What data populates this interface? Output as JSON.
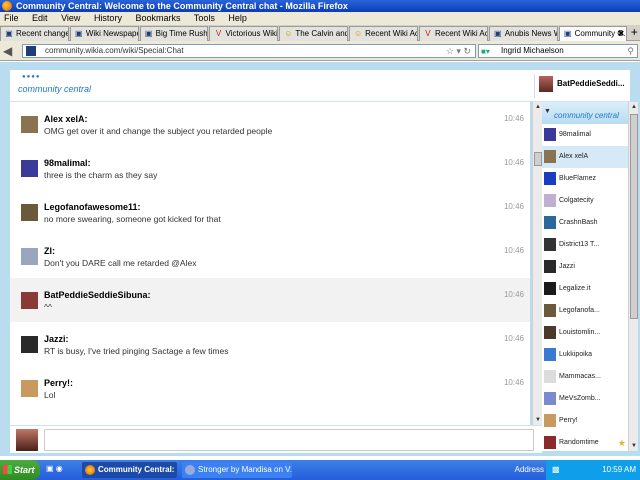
{
  "window": {
    "title": "Community Central: Welcome to the Community Central chat - Mozilla Firefox"
  },
  "menu": [
    "File",
    "Edit",
    "View",
    "History",
    "Bookmarks",
    "Tools",
    "Help"
  ],
  "tabs": [
    {
      "label": "Recent change...",
      "icon": "wiki-icon",
      "active": false
    },
    {
      "label": "Wiki Newspape...",
      "icon": "wiki-icon",
      "active": false
    },
    {
      "label": "Big Time Rush ...",
      "icon": "wiki-icon",
      "active": false
    },
    {
      "label": "Victorious Wiki ...",
      "icon": "v-icon",
      "active": false
    },
    {
      "label": "The Calvin and ...",
      "icon": "smiley-icon",
      "active": false
    },
    {
      "label": "Recent Wiki Ac...",
      "icon": "smiley-icon",
      "active": false
    },
    {
      "label": "Recent Wiki Ac...",
      "icon": "v-icon",
      "active": false
    },
    {
      "label": "Anubis News W...",
      "icon": "wiki-icon",
      "active": false
    },
    {
      "label": "Community C...",
      "icon": "wiki-icon",
      "active": true
    }
  ],
  "nav": {
    "url": "community.wikia.com/wiki/Special:Chat",
    "search_value": "Ingrid Michaelson"
  },
  "chat": {
    "logo_text": "community central",
    "current_user": "BatPeddieSeddi...",
    "room_name": "community central",
    "messages": [
      {
        "name": "Alex xelA:",
        "text": "OMG get over it and change the subject you retarded people",
        "time": "10:46",
        "avatar": "#8a7350",
        "highlight": false
      },
      {
        "name": "98malimal:",
        "text": "three is the charm as they say",
        "time": "10:46",
        "avatar": "#3a3a9a",
        "highlight": false
      },
      {
        "name": "Legofanofawesome11:",
        "text": "no more swearing, someone got kicked for that",
        "time": "10:46",
        "avatar": "#6b5a3a",
        "highlight": false
      },
      {
        "name": "Zl:",
        "text": "Don't you DARE call me retarded @Alex",
        "time": "10:46",
        "avatar": "#9aa6c0",
        "highlight": false
      },
      {
        "name": "BatPeddieSeddieSibuna:",
        "text": "^^",
        "time": "10:46",
        "avatar": "#8a3a34",
        "highlight": true
      },
      {
        "name": "Jazzi:",
        "text": "RT is busy, I've tried pinging Sactage a few times",
        "time": "10:46",
        "avatar": "#2a2a2a",
        "highlight": false
      },
      {
        "name": "Perry!:",
        "text": "Lol",
        "time": "10:46",
        "avatar": "#c89a60",
        "highlight": false
      }
    ],
    "users": [
      {
        "name": "98malimal",
        "avatar": "#3a3a9a",
        "selected": false
      },
      {
        "name": "Alex xelA",
        "avatar": "#8a7350",
        "selected": true
      },
      {
        "name": "BlueFlamez",
        "avatar": "#1a3cc0",
        "selected": false
      },
      {
        "name": "Colgatecity",
        "avatar": "#c0b0d0",
        "selected": false
      },
      {
        "name": "CrashnBash",
        "avatar": "#2a6a9a",
        "selected": false
      },
      {
        "name": "District13 T...",
        "avatar": "#333333",
        "selected": false
      },
      {
        "name": "Jazzi",
        "avatar": "#2a2a2a",
        "selected": false
      },
      {
        "name": "Legalize.it",
        "avatar": "#1a1a1a",
        "selected": false
      },
      {
        "name": "Legofanofa...",
        "avatar": "#6b5a3a",
        "selected": false
      },
      {
        "name": "Louistomlin...",
        "avatar": "#4a3a2a",
        "selected": false
      },
      {
        "name": "Lukkipoika",
        "avatar": "#3a7ad0",
        "selected": false
      },
      {
        "name": "Mammacas...",
        "avatar": "#dcdcdc",
        "selected": false
      },
      {
        "name": "MeVsZomb...",
        "avatar": "#7a8ad0",
        "selected": false
      },
      {
        "name": "Perry!",
        "avatar": "#c89a60",
        "selected": false
      },
      {
        "name": "Randomtime",
        "avatar": "#8a2a2a",
        "selected": false
      }
    ],
    "input_value": ""
  },
  "taskbar": {
    "start_label": "Start",
    "tasks": [
      {
        "label": "Community Central: ...",
        "active": true
      },
      {
        "label": "Stronger by Mandisa on V...",
        "active": false
      }
    ],
    "address_label": "Address",
    "clock": "10:59 AM"
  }
}
